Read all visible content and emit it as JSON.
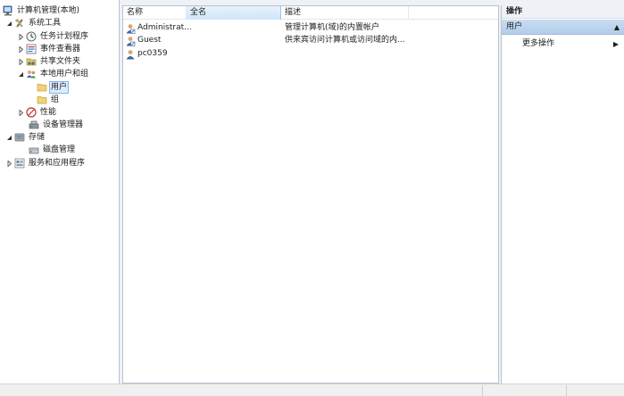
{
  "tree": {
    "root": "计算机管理(本地)",
    "system_tools": "系统工具",
    "task_scheduler": "任务计划程序",
    "event_viewer": "事件查看器",
    "shared_folders": "共享文件夹",
    "local_users_groups": "本地用户和组",
    "users": "用户",
    "groups": "组",
    "performance": "性能",
    "device_manager": "设备管理器",
    "storage": "存储",
    "disk_management": "磁盘管理",
    "services_apps": "服务和应用程序"
  },
  "list": {
    "columns": [
      "名称",
      "全名",
      "描述"
    ],
    "rows": [
      {
        "name": "Administrat...",
        "full_name": "",
        "description": "管理计算机(域)的内置帐户",
        "icon": "user-icon"
      },
      {
        "name": "Guest",
        "full_name": "",
        "description": "供来宾访问计算机或访问域的内...",
        "icon": "user-icon"
      },
      {
        "name": "pc0359",
        "full_name": "",
        "description": "",
        "icon": "user-icon"
      }
    ]
  },
  "actions": {
    "title": "操作",
    "section": "用户",
    "more_actions": "更多操作"
  },
  "colors": {
    "selection_fill": "#dcebfc",
    "selection_border": "#7eb4ea",
    "section_header": "#b3cdea"
  }
}
